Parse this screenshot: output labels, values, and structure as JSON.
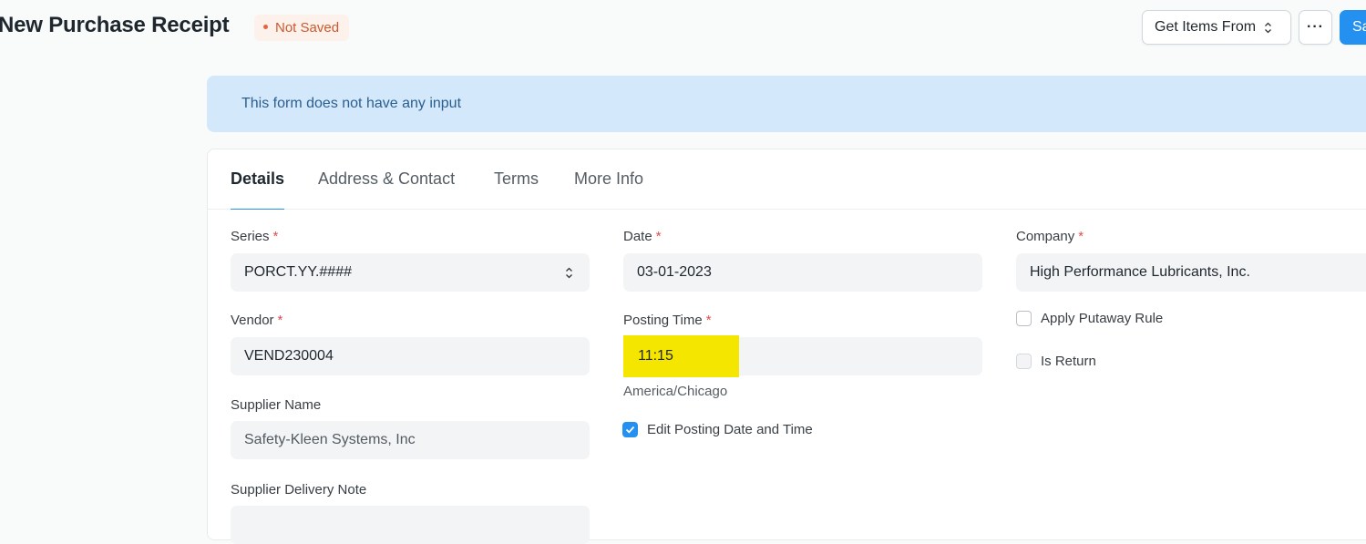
{
  "header": {
    "title": "New Purchase Receipt",
    "status": "Not Saved",
    "get_items_label": "Get Items From",
    "more_label": "···",
    "save_label": "Save"
  },
  "alert": {
    "message": "This form does not have any input"
  },
  "tabs": [
    {
      "label": "Details",
      "active": true
    },
    {
      "label": "Address & Contact",
      "active": false
    },
    {
      "label": "Terms",
      "active": false
    },
    {
      "label": "More Info",
      "active": false
    }
  ],
  "fields": {
    "series": {
      "label": "Series",
      "value": "PORCT.YY.####",
      "required": true
    },
    "vendor": {
      "label": "Vendor",
      "value": "VEND230004",
      "required": true
    },
    "supplier_name": {
      "label": "Supplier Name",
      "value": "Safety-Kleen Systems, Inc"
    },
    "supplier_delivery_note": {
      "label": "Supplier Delivery Note",
      "value": ""
    },
    "date": {
      "label": "Date",
      "value": "03-01-2023",
      "required": true
    },
    "posting_time": {
      "label": "Posting Time",
      "value": "11:15",
      "required": true,
      "timezone": "America/Chicago"
    },
    "edit_posting": {
      "label": "Edit Posting Date and Time",
      "checked": true
    },
    "company": {
      "label": "Company",
      "value": "High Performance Lubricants, Inc.",
      "required": true
    },
    "apply_putaway": {
      "label": "Apply Putaway Rule",
      "checked": false
    },
    "is_return": {
      "label": "Is Return",
      "checked": false,
      "disabled": true
    }
  },
  "colors": {
    "primary": "#2490ef",
    "alert_bg": "#d4e8fb",
    "status_text": "#cb5a2e",
    "highlight": "#f5e600"
  }
}
